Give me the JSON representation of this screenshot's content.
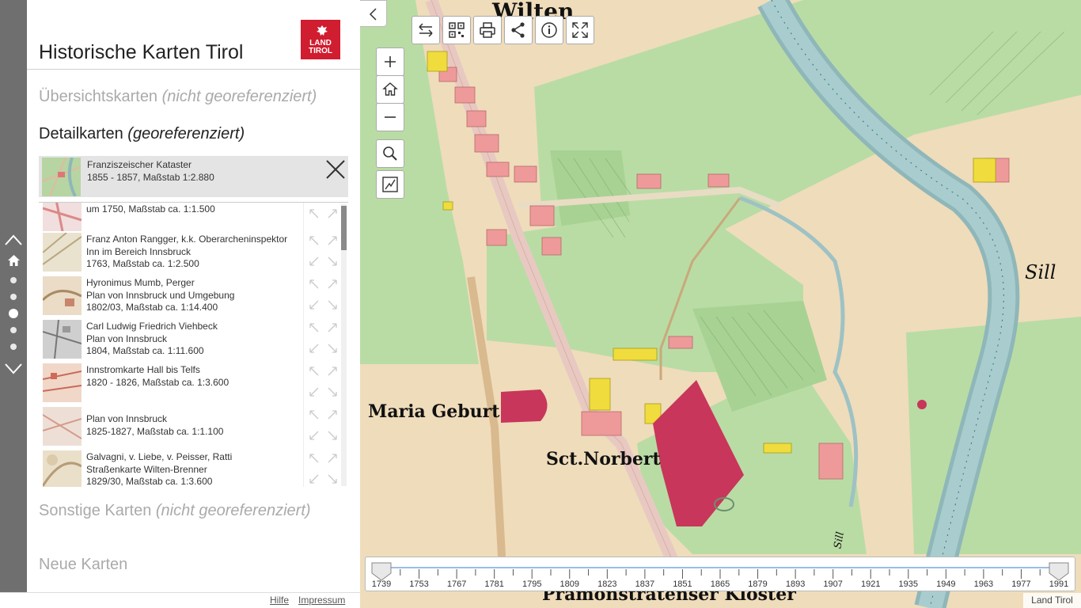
{
  "app": {
    "title": "Historische Karten Tirol",
    "logo_line1": "LAND",
    "logo_line2": "TIROL"
  },
  "sections": {
    "overview": {
      "label": "Übersichtskarten",
      "note": "(nicht georeferenziert)"
    },
    "detail": {
      "label": "Detailkarten",
      "note": "(georeferenziert)"
    },
    "other": {
      "label": "Sonstige Karten",
      "note": "(nicht georeferenziert)"
    },
    "new": {
      "label": "Neue Karten"
    }
  },
  "selected_map": {
    "name": "Franziszeischer Kataster",
    "info": "1855 - 1857, Maßstab 1:2.880"
  },
  "map_list": [
    {
      "line1": "um 1750, Maßstab ca. 1:1.500",
      "line2": "",
      "line3": ""
    },
    {
      "line1": "Franz Anton Rangger, k.k. Oberarcheninspektor",
      "line2": "Inn im Bereich Innsbruck",
      "line3": "1763, Maßstab ca. 1:2.500"
    },
    {
      "line1": "Hyronimus Mumb, Perger",
      "line2": "Plan von Innsbruck und Umgebung",
      "line3": "1802/03, Maßstab ca. 1:14.400"
    },
    {
      "line1": "Carl Ludwig Friedrich Viehbeck",
      "line2": "Plan von Innsbruck",
      "line3": "1804, Maßstab ca. 1:11.600"
    },
    {
      "line1": "Innstromkarte Hall bis Telfs",
      "line2": "1820 - 1826, Maßstab ca. 1:3.600",
      "line3": ""
    },
    {
      "line1": "Plan von Innsbruck",
      "line2": "1825-1827, Maßstab ca. 1:1.100",
      "line3": ""
    },
    {
      "line1": "Galvagni, v. Liebe, v. Peisser, Ratti",
      "line2": "Straßenkarte Wilten-Brenner",
      "line3": "1829/30, Maßstab ca. 1:3.600"
    }
  ],
  "footer": {
    "help": "Hilfe",
    "imprint": "Impressum"
  },
  "map_labels": {
    "wilten": "Wilten",
    "maria": "Maria Geburt",
    "norbert": "Sct.Norbert",
    "kloster": "Prämonstratenser Kloster",
    "sill": "Sill",
    "sill2": "Sill"
  },
  "timeline": {
    "years": [
      "1739",
      "1753",
      "1767",
      "1781",
      "1795",
      "1809",
      "1823",
      "1837",
      "1851",
      "1865",
      "1879",
      "1893",
      "1907",
      "1921",
      "1935",
      "1949",
      "1963",
      "1977",
      "1991"
    ],
    "range_start": 1739,
    "range_end": 1991
  },
  "credit": "Land Tirol",
  "colors": {
    "accent": "#d01d2f",
    "rail": "#6f6f6f",
    "meadow": "#b9dca5",
    "field": "#efdcbb",
    "river": "#9ec2c4",
    "church": "#c8365b"
  }
}
